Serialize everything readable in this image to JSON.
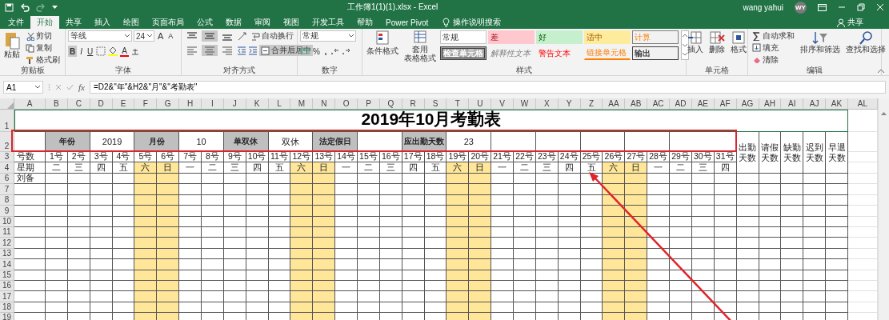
{
  "window": {
    "title": "工作簿1(1)(1).xlsx  -  Excel",
    "user": "wang yahui",
    "avatar": "WY"
  },
  "tabs": [
    {
      "label": "文件",
      "selected": false
    },
    {
      "label": "开始",
      "selected": true
    },
    {
      "label": "共享",
      "selected": false
    },
    {
      "label": "插入",
      "selected": false
    },
    {
      "label": "绘图",
      "selected": false
    },
    {
      "label": "页面布局",
      "selected": false
    },
    {
      "label": "公式",
      "selected": false
    },
    {
      "label": "数据",
      "selected": false
    },
    {
      "label": "审阅",
      "selected": false
    },
    {
      "label": "视图",
      "selected": false
    },
    {
      "label": "开发工具",
      "selected": false
    },
    {
      "label": "帮助",
      "selected": false
    },
    {
      "label": "Power Pivot",
      "selected": false
    }
  ],
  "tell_me": "操作说明搜索",
  "share": "共享",
  "ribbon": {
    "clipboard": {
      "paste": "粘贴",
      "items": [
        "剪切",
        "复制",
        "格式刷"
      ],
      "label": "剪贴板"
    },
    "font": {
      "name": "等线",
      "size": "24",
      "grow": "A",
      "shrink": "A",
      "paint_glyph": "A",
      "styles": [
        {
          "label": "B",
          "selected": true
        },
        {
          "label": "I",
          "selected": false
        },
        {
          "label": "U",
          "selected": false
        }
      ],
      "label": "字体"
    },
    "alignment": {
      "vertical": [
        {
          "kind": "top",
          "selected": false
        },
        {
          "kind": "middle",
          "selected": true
        },
        {
          "kind": "bottom",
          "selected": false
        }
      ],
      "horizontal": [
        {
          "kind": "left",
          "selected": false
        },
        {
          "kind": "center",
          "selected": true
        },
        {
          "kind": "right",
          "selected": false
        }
      ],
      "wrap": "自动换行",
      "merge": {
        "label": "合并后居中",
        "selected": true
      },
      "label": "对齐方式"
    },
    "number": {
      "format": "常规",
      "percent": "%",
      "label": "数字"
    },
    "styles": {
      "conditional": "条件格式",
      "table": [
        "套用",
        "表格格式"
      ],
      "gallery": [
        {
          "label": "常规",
          "kind": "normal"
        },
        {
          "label": "差",
          "kind": "bad"
        },
        {
          "label": "好",
          "kind": "good"
        },
        {
          "label": "适中",
          "kind": "neutral"
        },
        {
          "label": "计算",
          "kind": "calculation"
        },
        {
          "label": "检查单元格",
          "kind": "check"
        },
        {
          "label": "解释性文本",
          "kind": "explanatory"
        },
        {
          "label": "警告文本",
          "kind": "warning"
        },
        {
          "label": "链接单元格",
          "kind": "linked"
        },
        {
          "label": "输出",
          "kind": "output"
        }
      ],
      "label": "样式"
    },
    "cells": {
      "buttons": [
        "插入",
        "删除",
        "格式"
      ],
      "label": "单元格"
    },
    "editing": {
      "items": [
        "自动求和",
        "填充",
        "清除"
      ],
      "buttons": [
        "排序和筛选",
        "查找和选择"
      ],
      "label": "编辑"
    }
  },
  "formula_bar": {
    "name_box": "A1",
    "fx": "fx",
    "formula": "=D2&\"年\"&H2&\"月\"&\"考勤表\""
  },
  "sheet": {
    "columns": [
      "A",
      "B",
      "C",
      "D",
      "E",
      "F",
      "G",
      "H",
      "I",
      "J",
      "K",
      "L",
      "M",
      "N",
      "O",
      "P",
      "Q",
      "R",
      "S",
      "T",
      "U",
      "V",
      "W",
      "X",
      "Y",
      "Z",
      "AA",
      "AB",
      "AC",
      "AD",
      "AE",
      "AF",
      "AG",
      "AH",
      "AI",
      "AJ",
      "AK",
      "AL"
    ],
    "header_rows": [
      "1",
      "2",
      "3",
      "4"
    ],
    "title": "2019年10月考勤表",
    "params": [
      {
        "kind": "label",
        "text": "年份"
      },
      {
        "kind": "value",
        "text": "2019"
      },
      {
        "kind": "label",
        "text": "月份"
      },
      {
        "kind": "value",
        "text": "10"
      },
      {
        "kind": "label",
        "text": "单双休"
      },
      {
        "kind": "value",
        "text": "双休"
      },
      {
        "kind": "label",
        "text": "法定假日"
      },
      {
        "kind": "blank"
      },
      {
        "kind": "label",
        "text": "应出勤天数"
      },
      {
        "kind": "value",
        "text": "23"
      }
    ],
    "day_label": "号数",
    "weekday_label": "星期",
    "days": [
      {
        "number": "1号",
        "weekday": "二",
        "weekend": false
      },
      {
        "number": "2号",
        "weekday": "三",
        "weekend": false
      },
      {
        "number": "3号",
        "weekday": "四",
        "weekend": false
      },
      {
        "number": "4号",
        "weekday": "五",
        "weekend": false
      },
      {
        "number": "5号",
        "weekday": "六",
        "weekend": true
      },
      {
        "number": "6号",
        "weekday": "日",
        "weekend": true
      },
      {
        "number": "7号",
        "weekday": "一",
        "weekend": false
      },
      {
        "number": "8号",
        "weekday": "二",
        "weekend": false
      },
      {
        "number": "9号",
        "weekday": "三",
        "weekend": false
      },
      {
        "number": "10号",
        "weekday": "四",
        "weekend": false
      },
      {
        "number": "11号",
        "weekday": "五",
        "weekend": false
      },
      {
        "number": "12号",
        "weekday": "六",
        "weekend": true
      },
      {
        "number": "13号",
        "weekday": "日",
        "weekend": true
      },
      {
        "number": "14号",
        "weekday": "一",
        "weekend": false
      },
      {
        "number": "15号",
        "weekday": "二",
        "weekend": false
      },
      {
        "number": "16号",
        "weekday": "三",
        "weekend": false
      },
      {
        "number": "17号",
        "weekday": "四",
        "weekend": false
      },
      {
        "number": "18号",
        "weekday": "五",
        "weekend": false
      },
      {
        "number": "19号",
        "weekday": "六",
        "weekend": true
      },
      {
        "number": "20号",
        "weekday": "日",
        "weekend": true
      },
      {
        "number": "21号",
        "weekday": "一",
        "weekend": false
      },
      {
        "number": "22号",
        "weekday": "二",
        "weekend": false
      },
      {
        "number": "23号",
        "weekday": "三",
        "weekend": false
      },
      {
        "number": "24号",
        "weekday": "四",
        "weekend": false
      },
      {
        "number": "25号",
        "weekday": "五",
        "weekend": false
      },
      {
        "number": "26号",
        "weekday": "六",
        "weekend": true
      },
      {
        "number": "27号",
        "weekday": "日",
        "weekend": true
      },
      {
        "number": "28号",
        "weekday": "一",
        "weekend": false
      },
      {
        "number": "29号",
        "weekday": "二",
        "weekend": false
      },
      {
        "number": "30号",
        "weekday": "三",
        "weekend": false
      },
      {
        "number": "31号",
        "weekday": "四",
        "weekend": false
      }
    ],
    "summary": [
      "出勤天数",
      "请假天数",
      "缺勤天数",
      "迟到天数",
      "早退天数"
    ],
    "rows": [
      {
        "number": "6",
        "name": "刘备"
      },
      {
        "number": "7"
      },
      {
        "number": "8"
      },
      {
        "number": "9"
      },
      {
        "number": "10"
      },
      {
        "number": "11"
      },
      {
        "number": "12"
      },
      {
        "number": "13"
      },
      {
        "number": "14"
      },
      {
        "number": "15"
      },
      {
        "number": "16"
      },
      {
        "number": "17"
      },
      {
        "number": "18"
      },
      {
        "number": "19"
      }
    ]
  }
}
